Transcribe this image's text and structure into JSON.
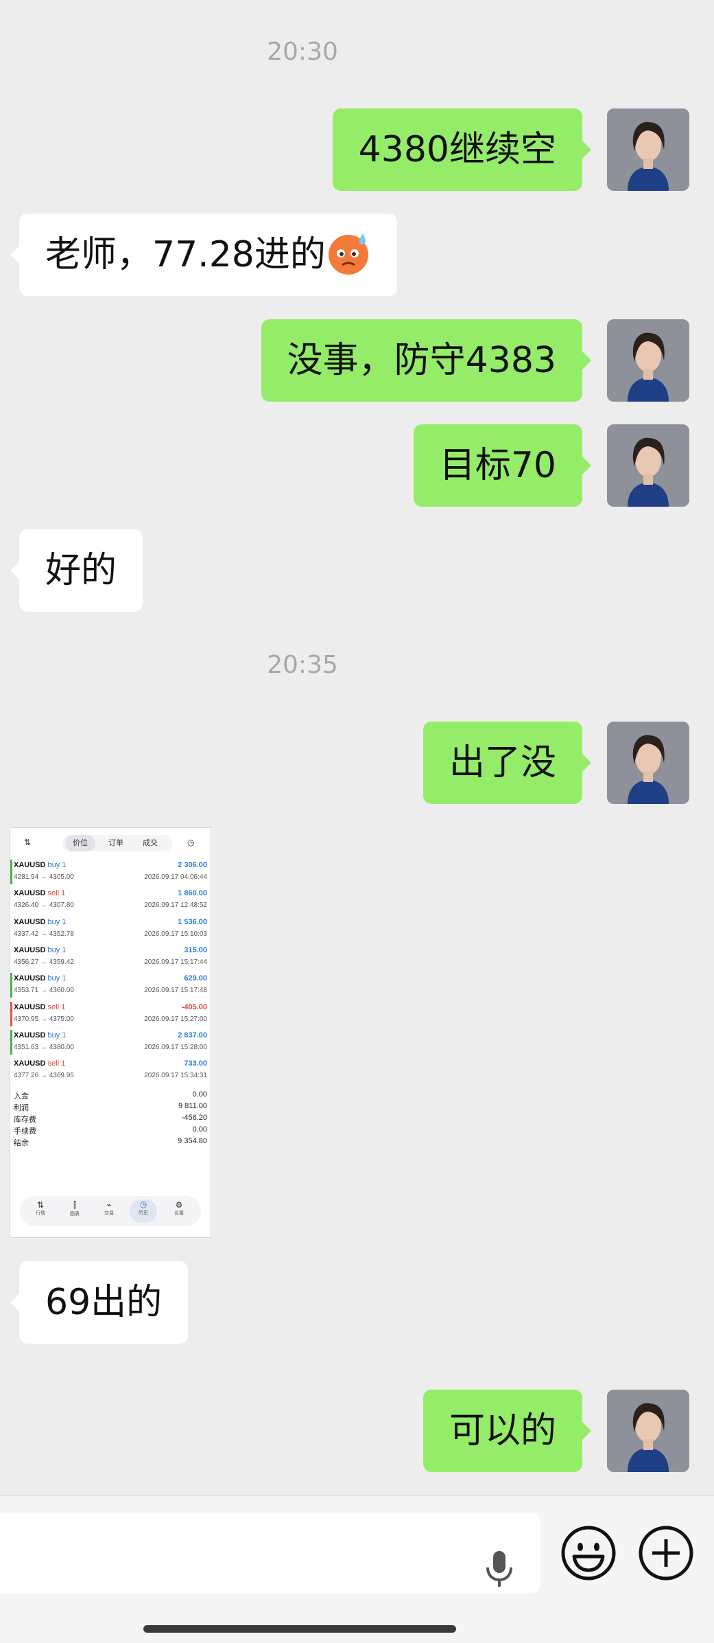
{
  "timestamps": [
    "20:30",
    "20:35"
  ],
  "messages": [
    {
      "side": "out",
      "text": "4380继续空"
    },
    {
      "side": "in",
      "text": "老师，77.28进的",
      "emoji": "sweat-face"
    },
    {
      "side": "out",
      "text": "没事，防守4383"
    },
    {
      "side": "out",
      "text": "目标70"
    },
    {
      "side": "in",
      "text": "好的"
    },
    {
      "side": "out",
      "text": "出了没"
    },
    {
      "side": "in",
      "text": "69出的"
    },
    {
      "side": "out",
      "text": "可以的"
    }
  ],
  "screenshot": {
    "tabs": [
      "价位",
      "订单",
      "成交"
    ],
    "trades": [
      {
        "symbol": "XAUUSD",
        "side": "buy 1",
        "prices": "4281.94 → 4305.00",
        "pnl": "2 306.00",
        "time": "2026.09.17 04:06:44",
        "bar": "#4cae4f",
        "color": "#2a78d6"
      },
      {
        "symbol": "XAUUSD",
        "side": "sell 1",
        "prices": "4326.40 → 4307.80",
        "pnl": "1 860.00",
        "time": "2026.09.17 12:48:52",
        "bar": "",
        "color": "#2a78d6"
      },
      {
        "symbol": "XAUUSD",
        "side": "buy 1",
        "prices": "4337.42 → 4352.78",
        "pnl": "1 536.00",
        "time": "2026.09.17 15:10:03",
        "bar": "",
        "color": "#2a78d6"
      },
      {
        "symbol": "XAUUSD",
        "side": "buy 1",
        "prices": "4356.27 → 4359.42",
        "pnl": "315.00",
        "time": "2026.09.17 15:17:44",
        "bar": "",
        "color": "#2a78d6"
      },
      {
        "symbol": "XAUUSD",
        "side": "buy 1",
        "prices": "4353.71 → 4360.00",
        "pnl": "629.00",
        "time": "2026.09.17 15:17:48",
        "bar": "#4cae4f",
        "color": "#2a78d6"
      },
      {
        "symbol": "XAUUSD",
        "side": "sell 1",
        "prices": "4370.95 → 4375.00",
        "pnl": "-405.00",
        "time": "2026.09.17 15:27:00",
        "bar": "#e0544a",
        "color": "#d9453b"
      },
      {
        "symbol": "XAUUSD",
        "side": "buy 1",
        "prices": "4351.63 → 4380.00",
        "pnl": "2 837.00",
        "time": "2026.09.17 15:28:00",
        "bar": "#4cae4f",
        "color": "#2a78d6"
      },
      {
        "symbol": "XAUUSD",
        "side": "sell 1",
        "prices": "4377.26 → 4369.95",
        "pnl": "733.00",
        "time": "2026.09.17 15:34:31",
        "bar": "",
        "color": "#2a78d6"
      }
    ],
    "summary": [
      {
        "label": "入金",
        "value": "0.00"
      },
      {
        "label": "利润",
        "value": "9 811.00"
      },
      {
        "label": "库存费",
        "value": "-456.20"
      },
      {
        "label": "手续费",
        "value": "0.00"
      },
      {
        "label": "结余",
        "value": "9 354.80"
      }
    ],
    "nav": [
      "行情",
      "图表",
      "交易",
      "历史",
      "设置"
    ]
  },
  "input": {
    "mic": "microphone-icon",
    "emoji": "emoji-icon",
    "plus": "plus-icon"
  }
}
